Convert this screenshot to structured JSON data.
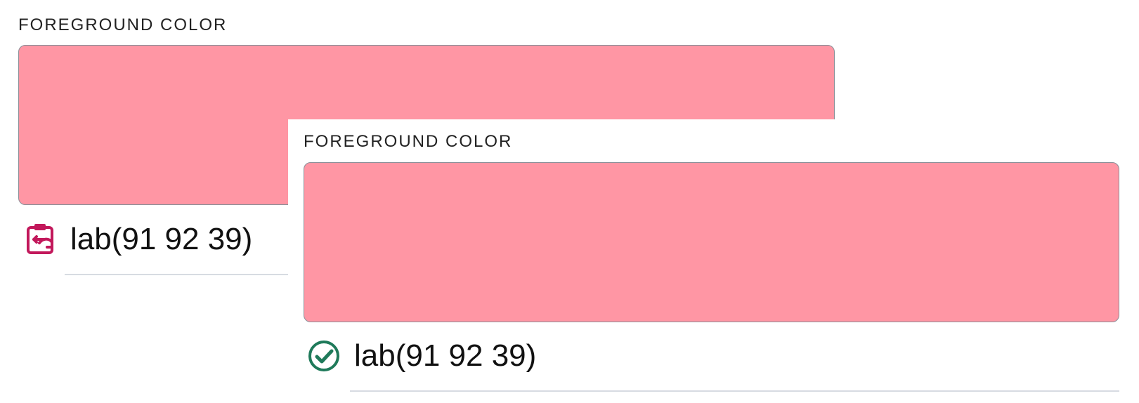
{
  "panels": [
    {
      "label": "FOREGROUND COLOR",
      "swatch_color": "#ff96a4",
      "value": "lab(91 92 39)",
      "action_icon": "clipboard-paste-icon",
      "icon_color": "#c2185b"
    },
    {
      "label": "FOREGROUND COLOR",
      "swatch_color": "#ff96a4",
      "value": "lab(91 92 39)",
      "status_icon": "check-circle-icon",
      "icon_color": "#1f7a5a"
    }
  ]
}
